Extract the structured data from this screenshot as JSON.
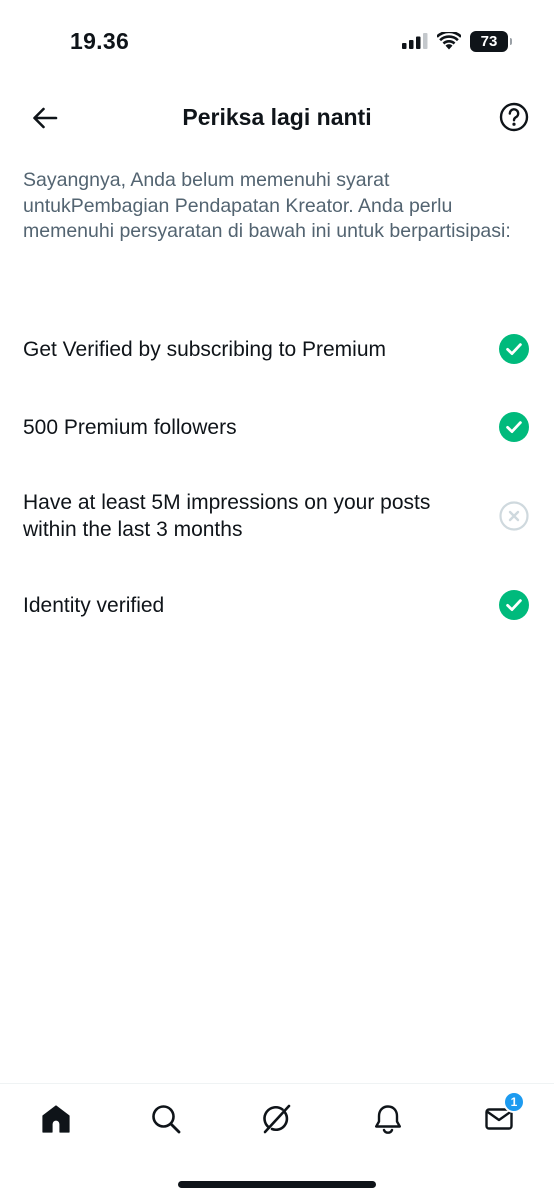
{
  "status_bar": {
    "time": "19.36",
    "battery": "73",
    "icons": [
      "cellular-signal-icon",
      "wifi-icon",
      "battery-icon"
    ]
  },
  "header": {
    "title": "Periksa lagi nanti",
    "back_icon": "arrow-left-icon",
    "help_icon": "question-circle-icon"
  },
  "description": "Sayangnya, Anda belum memenuhi syarat untukPembagian Pendapatan Kreator. Anda perlu memenuhi persyaratan di bawah ini untuk berpartisipasi:",
  "requirements": [
    {
      "label": "Get Verified by subscribing to Premium",
      "met": true
    },
    {
      "label": "500 Premium followers",
      "met": true
    },
    {
      "label": "Have at least 5M impressions on your posts within the last 3 months",
      "met": false
    },
    {
      "label": "Identity verified",
      "met": true
    }
  ],
  "tab_bar": {
    "tabs": [
      "home-icon",
      "search-icon",
      "grok-icon",
      "bell-icon",
      "mail-icon"
    ],
    "messages_badge": "1"
  },
  "colors": {
    "success": "#00ba7c",
    "unmet": "#cfd9de",
    "badge": "#1d9bf0",
    "text": "#0f1419",
    "secondary_text": "#536471"
  }
}
